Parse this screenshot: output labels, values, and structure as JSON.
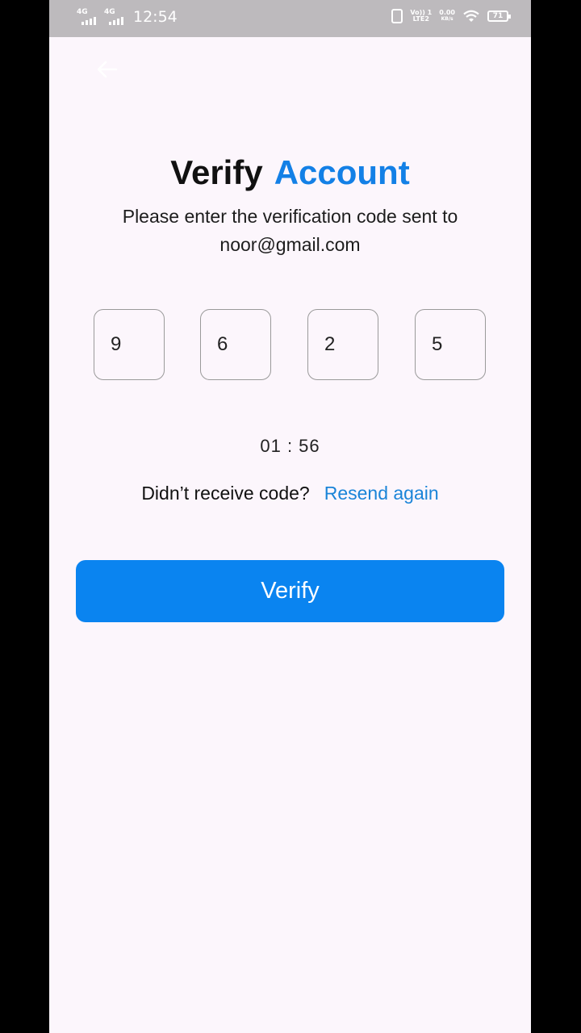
{
  "status_bar": {
    "network_1": "4G",
    "network_2": "4G",
    "time": "12:54",
    "volte_line1": "Vo)) 1",
    "volte_line2": "LTE2",
    "speed_value": "0.00",
    "speed_unit": "KB/s",
    "battery": "71"
  },
  "header": {
    "back_icon": "arrow-left-icon"
  },
  "title": {
    "part1": "Verify",
    "part2": "Account",
    "accent_color": "#1380e6"
  },
  "subtitle": {
    "line1": "Please  enter the verification code sent to",
    "line2": "noor@gmail.com"
  },
  "otp": {
    "digits": [
      "9",
      "6",
      "2",
      "5"
    ]
  },
  "timer": "01 : 56",
  "resend": {
    "question": "Didn’t receive code?",
    "link": "Resend again"
  },
  "verify_button": {
    "label": "Verify",
    "color": "#0a84f0"
  }
}
